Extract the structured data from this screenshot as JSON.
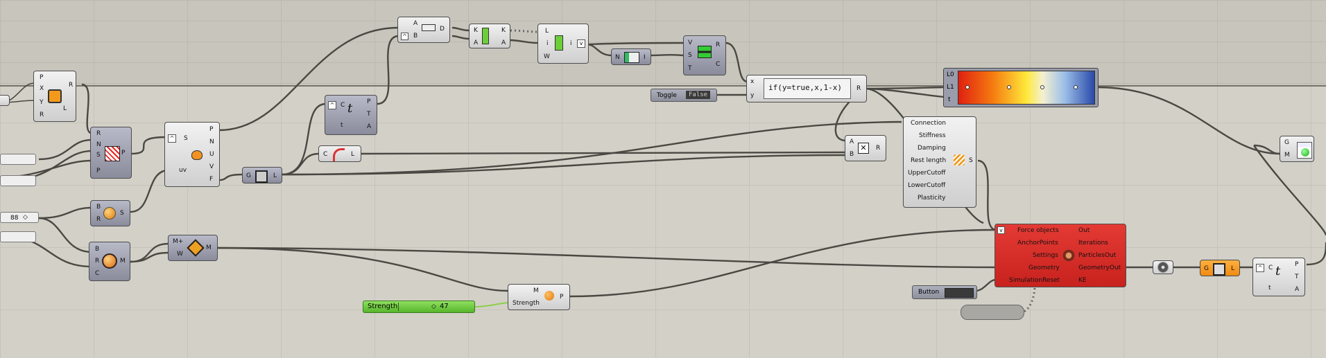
{
  "canvas": {
    "colors": {
      "background": "#d3d0c7",
      "wire": "#4a4842",
      "red_component": "#d42b26",
      "green_slider": "#6cc83e"
    }
  },
  "components": {
    "point_xyr": {
      "inputs": [
        "P",
        "X",
        "Y",
        "R"
      ],
      "outputs": [
        "R",
        "L"
      ],
      "icon": "rectangle-icon"
    },
    "populate": {
      "inputs": [
        "R",
        "N",
        "S",
        "P"
      ],
      "outputs": [
        "P"
      ],
      "icon": "populate-icon"
    },
    "sphere": {
      "inputs": [
        "B",
        "R"
      ],
      "outputs": [
        "S"
      ],
      "icon": "sphere-icon"
    },
    "mesh_brc": {
      "inputs": [
        "B",
        "R",
        "C"
      ],
      "outputs": [
        "M"
      ],
      "icon": "mesh-sphere-icon"
    },
    "surface_eval": {
      "inputs": [
        "S",
        "uv"
      ],
      "outputs": [
        "P",
        "N",
        "U",
        "V",
        "F"
      ],
      "icon": "surface-eval-icon"
    },
    "mesh_join": {
      "inputs": [
        "M+",
        "W"
      ],
      "outputs": [
        "M"
      ],
      "icon": "mesh-join-icon"
    },
    "gl_small": {
      "inputs": [
        "G"
      ],
      "outputs": [
        "L"
      ],
      "icon": "edges-icon"
    },
    "curve_ct": {
      "inputs": [
        "C",
        "t"
      ],
      "outputs": [
        "P",
        "T",
        "A"
      ],
      "icon": "curve-param-icon"
    },
    "cl": {
      "inputs": [
        "C"
      ],
      "outputs": [
        "L"
      ],
      "icon": "curve-length-icon"
    },
    "abd": {
      "inputs": [
        "A",
        "B"
      ],
      "outputs": [
        "D"
      ],
      "icon": "distance-icon"
    },
    "sort": {
      "inputs": [
        "K",
        "A"
      ],
      "outputs": [
        "K",
        "A"
      ],
      "icon": "sort-icon"
    },
    "list_item": {
      "inputs": [
        "L",
        "i",
        "W"
      ],
      "outputs": [
        "i"
      ],
      "icon": "list-item-icon"
    },
    "ni": {
      "inputs": [
        "N"
      ],
      "outputs": [
        "I"
      ],
      "icon": "series-icon"
    },
    "vst": {
      "inputs": [
        "V",
        "S",
        "T"
      ],
      "outputs": [
        "R",
        "C"
      ],
      "icon": "remap-icon"
    },
    "expression": {
      "inputs": [
        "x",
        "y"
      ],
      "outputs": [
        "R"
      ],
      "text": "if(y=true,x,1-x)"
    },
    "toggle": {
      "label": "Toggle",
      "value": "False"
    },
    "gradient": {
      "inputs": [
        "L0",
        "L1",
        "t"
      ]
    },
    "multiply": {
      "inputs": [
        "A",
        "B"
      ],
      "outputs": [
        "R"
      ],
      "icon": "multiply-icon"
    },
    "spring": {
      "inputs": [
        "Connection",
        "Stiffness",
        "Damping",
        "Rest length",
        "UpperCutoff",
        "LowerCutoff",
        "Plasticity"
      ],
      "outputs": [
        "S"
      ],
      "icon": "spring-icon"
    },
    "solver": {
      "inputs": [
        "Force objects",
        "AnchorPoints",
        "Settings",
        "Geometry",
        "SimulationReset"
      ],
      "outputs": [
        "Out",
        "Iterations",
        "ParticlesOut",
        "GeometryOut",
        "KE"
      ],
      "icon": "kangaroo-icon"
    },
    "button": {
      "label": "Button"
    },
    "pressure": {
      "inputs": [
        "M",
        "Strength"
      ],
      "outputs": [
        "P"
      ],
      "icon": "pressure-icon"
    },
    "strength_slider": {
      "label": "Strength",
      "value": "47"
    },
    "slider_88": {
      "value": "88"
    },
    "explode": {
      "icon": "explode-icon"
    },
    "gl_orange": {
      "inputs": [
        "G"
      ],
      "outputs": [
        "L"
      ],
      "icon": "edges-icon"
    },
    "curve_ct2": {
      "inputs": [
        "C",
        "t"
      ],
      "outputs": [
        "P",
        "T",
        "A"
      ],
      "icon": "curve-param-icon"
    },
    "preview": {
      "inputs": [
        "G",
        "M"
      ],
      "icon": "custom-preview-icon"
    }
  }
}
